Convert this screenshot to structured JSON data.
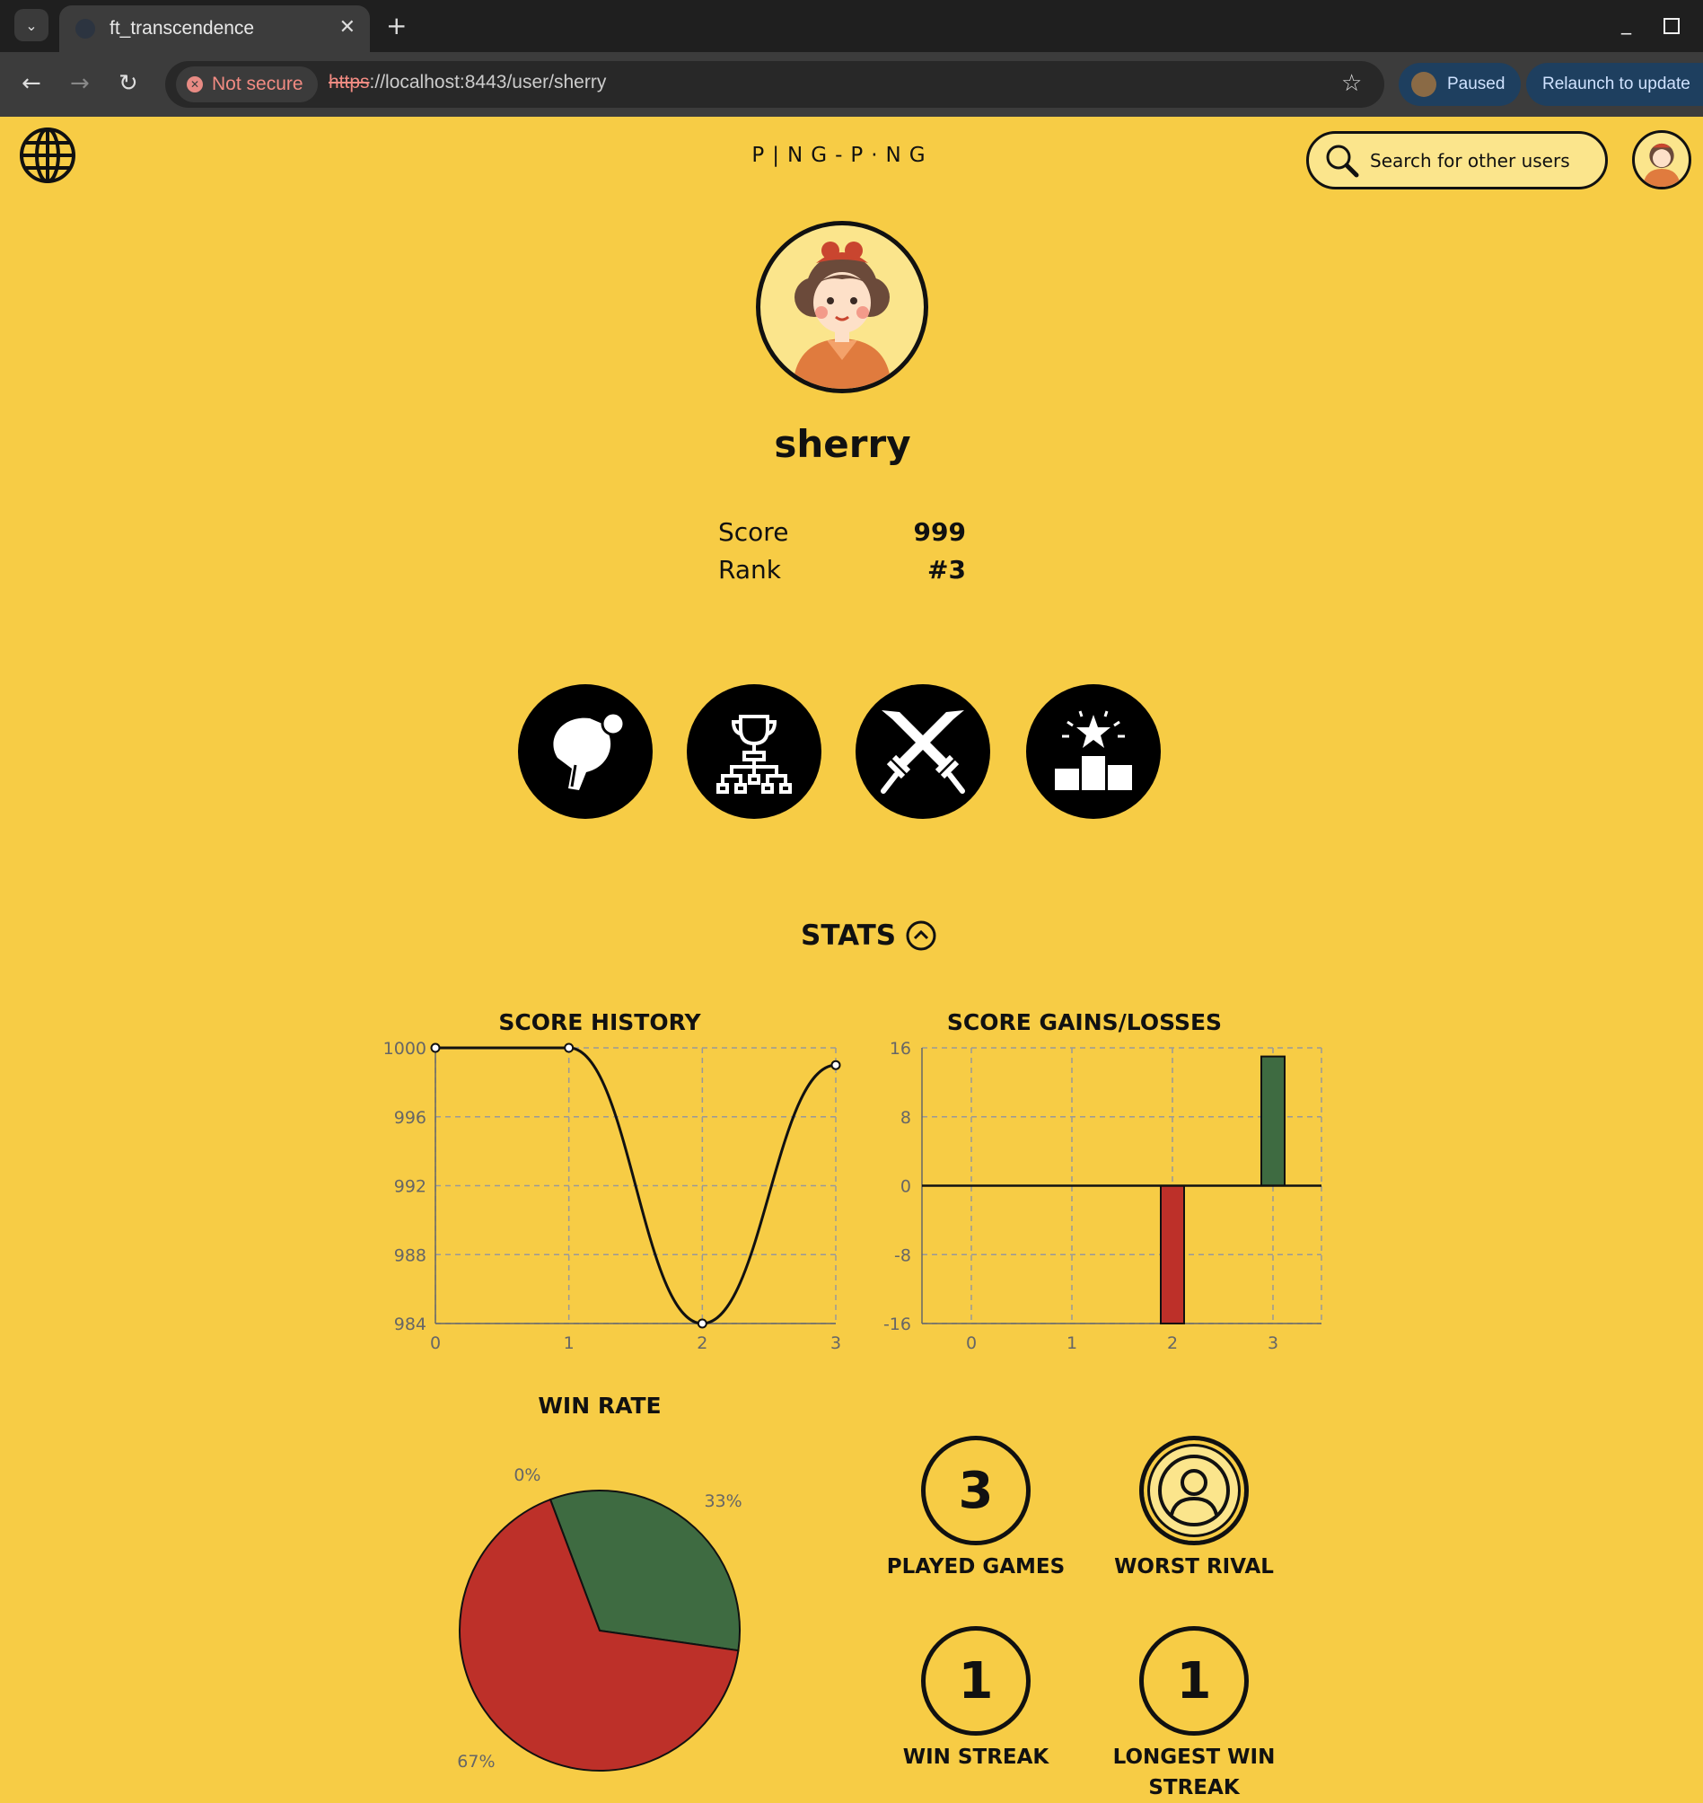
{
  "browser": {
    "tab_title": "ft_transcendence",
    "security_label": "Not secure",
    "url_scheme": "https",
    "url_rest": "://localhost:8443/user/sherry",
    "paused_label": "Paused",
    "relaunch_label": "Relaunch to update"
  },
  "header": {
    "brand": "P|NG-P·NG",
    "search_placeholder": "Search for other users"
  },
  "profile": {
    "username": "sherry",
    "score_label": "Score",
    "score_value": "999",
    "rank_label": "Rank",
    "rank_value": "#3"
  },
  "actions": [
    "ping-pong-icon",
    "tournament-icon",
    "crossed-swords-icon",
    "podium-icon"
  ],
  "stats": {
    "heading": "STATS",
    "played_games_value": "3",
    "played_games_label": "PLAYED GAMES",
    "worst_rival_label": "WORST RIVAL",
    "win_streak_value": "1",
    "win_streak_label": "WIN STREAK",
    "longest_win_streak_value": "1",
    "longest_win_streak_label": "LONGEST WIN STREAK"
  },
  "colors": {
    "background": "#f7cc45",
    "win": "#3e6b41",
    "loss": "#bd3029",
    "light": "#fbe58c"
  },
  "chart_data": [
    {
      "type": "line",
      "title": "SCORE HISTORY",
      "x": [
        0,
        1,
        2,
        3
      ],
      "y": [
        1000,
        1000,
        984,
        999
      ],
      "ylim": [
        984,
        1000
      ],
      "yticks": [
        984,
        988,
        992,
        996,
        1000
      ],
      "grid": true
    },
    {
      "type": "bar",
      "title": "SCORE GAINS/LOSSES",
      "x": [
        0,
        1,
        2,
        3
      ],
      "values": [
        0,
        0,
        -16,
        15
      ],
      "ylim": [
        -16,
        16
      ],
      "yticks": [
        -16,
        -8,
        0,
        8,
        16
      ],
      "grid": true
    },
    {
      "type": "pie",
      "title": "WIN RATE",
      "slices": [
        {
          "label": "33%",
          "value": 33,
          "color": "#3e6b41"
        },
        {
          "label": "67%",
          "value": 67,
          "color": "#bd3029"
        },
        {
          "label": "0%",
          "value": 0,
          "color": "#111111"
        }
      ]
    }
  ]
}
